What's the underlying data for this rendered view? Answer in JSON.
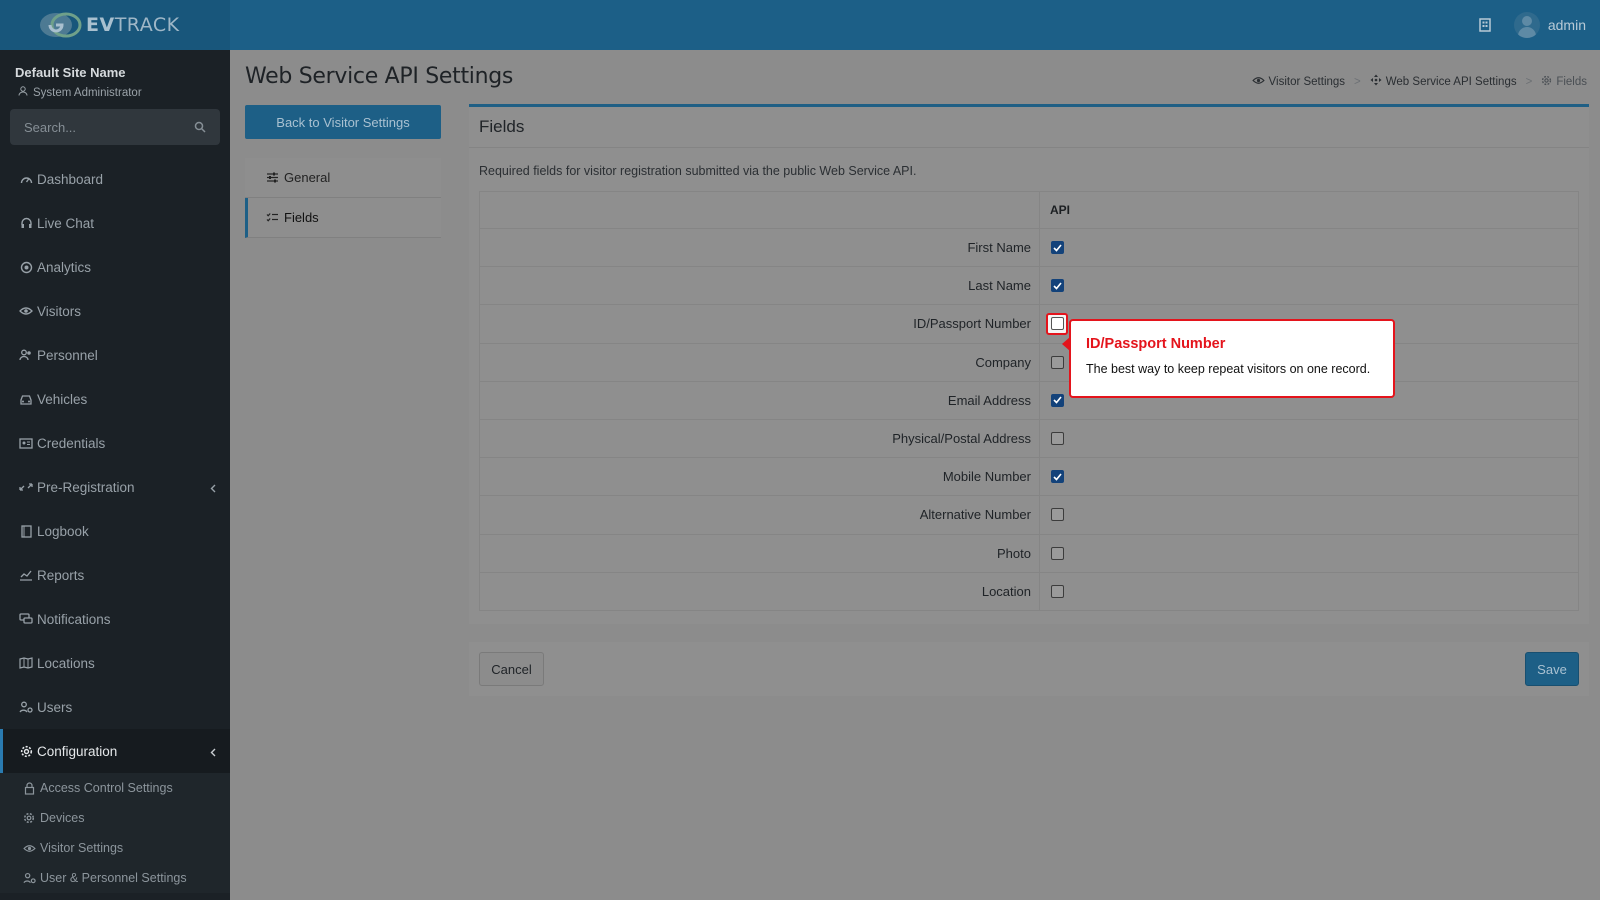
{
  "header": {
    "logo_text_bold": "EV",
    "logo_text_rest": "TRACK",
    "username": "admin"
  },
  "sidebar": {
    "site_name": "Default Site Name",
    "role": "System Administrator",
    "search_placeholder": "Search...",
    "items": [
      {
        "label": "Dashboard",
        "icon": "gauge-icon"
      },
      {
        "label": "Live Chat",
        "icon": "headset-icon"
      },
      {
        "label": "Analytics",
        "icon": "target-icon"
      },
      {
        "label": "Visitors",
        "icon": "eye-icon"
      },
      {
        "label": "Personnel",
        "icon": "users-icon"
      },
      {
        "label": "Vehicles",
        "icon": "car-icon"
      },
      {
        "label": "Credentials",
        "icon": "id-card-icon"
      },
      {
        "label": "Pre-Registration",
        "icon": "exchange-icon"
      },
      {
        "label": "Logbook",
        "icon": "book-icon"
      },
      {
        "label": "Reports",
        "icon": "chart-icon"
      },
      {
        "label": "Notifications",
        "icon": "comments-icon"
      },
      {
        "label": "Locations",
        "icon": "map-icon"
      },
      {
        "label": "Users",
        "icon": "users-cog-icon"
      },
      {
        "label": "Configuration",
        "icon": "gear-icon"
      }
    ],
    "sub_items": [
      {
        "label": "Access Control Settings",
        "icon": "lock-icon"
      },
      {
        "label": "Devices",
        "icon": "cog-icon"
      },
      {
        "label": "Visitor Settings",
        "icon": "eye-icon"
      },
      {
        "label": "User & Personnel Settings",
        "icon": "user-cog-icon"
      }
    ]
  },
  "page": {
    "title": "Web Service API Settings",
    "breadcrumb": [
      "Visitor Settings",
      "Web Service API Settings",
      "Fields"
    ],
    "back_button": "Back to Visitor Settings",
    "tabs": [
      "General",
      "Fields"
    ],
    "panel_title": "Fields",
    "description": "Required fields for visitor registration submitted via the public Web Service API.",
    "column_header": "API",
    "fields": [
      {
        "label": "First Name",
        "checked": true
      },
      {
        "label": "Last Name",
        "checked": true
      },
      {
        "label": "ID/Passport Number",
        "checked": false
      },
      {
        "label": "Company",
        "checked": false
      },
      {
        "label": "Email Address",
        "checked": true
      },
      {
        "label": "Physical/Postal Address",
        "checked": false
      },
      {
        "label": "Mobile Number",
        "checked": true
      },
      {
        "label": "Alternative Number",
        "checked": false
      },
      {
        "label": "Photo",
        "checked": false
      },
      {
        "label": "Location",
        "checked": false
      }
    ],
    "cancel_label": "Cancel",
    "save_label": "Save"
  },
  "tooltip": {
    "title": "ID/Passport Number",
    "body": "The best way to keep repeat visitors on one record."
  }
}
